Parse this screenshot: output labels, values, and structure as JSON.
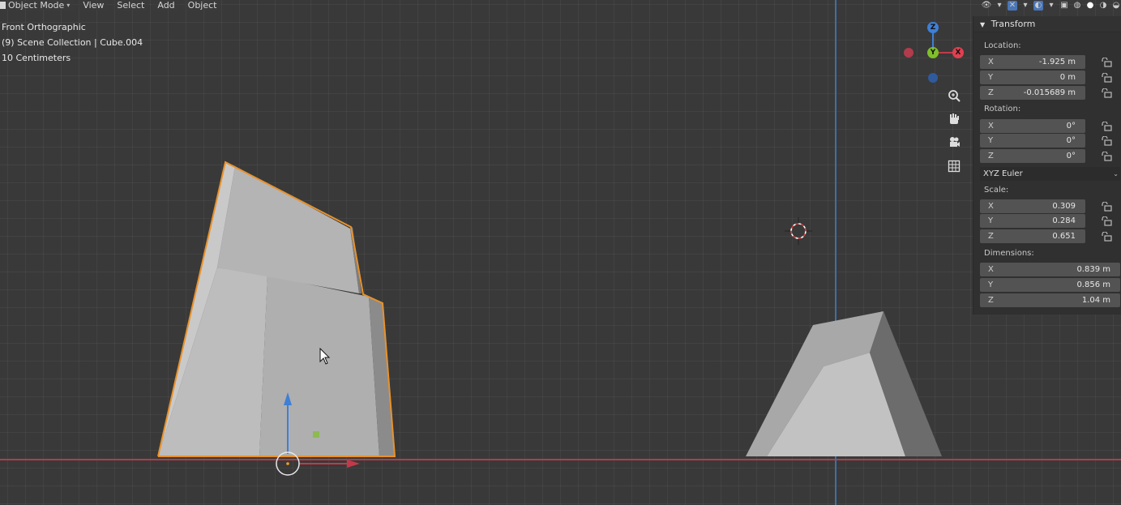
{
  "header": {
    "mode_label": "Object Mode",
    "menu": [
      "View",
      "Select",
      "Add",
      "Object"
    ]
  },
  "overlay": {
    "view_name": "Front Orthographic",
    "collection": "(9) Scene Collection | Cube.004",
    "scale_text": "10 Centimeters"
  },
  "gizmo": {
    "x": "X",
    "y": "Y",
    "z": "Z"
  },
  "panel": {
    "title": "Transform",
    "location": {
      "label": "Location:",
      "rows": [
        {
          "axis": "X",
          "value": "-1.925 m"
        },
        {
          "axis": "Y",
          "value": "0 m"
        },
        {
          "axis": "Z",
          "value": "-0.015689 m"
        }
      ]
    },
    "rotation": {
      "label": "Rotation:",
      "rows": [
        {
          "axis": "X",
          "value": "0°"
        },
        {
          "axis": "Y",
          "value": "0°"
        },
        {
          "axis": "Z",
          "value": "0°"
        }
      ]
    },
    "rotation_mode": "XYZ Euler",
    "scale": {
      "label": "Scale:",
      "rows": [
        {
          "axis": "X",
          "value": "0.309"
        },
        {
          "axis": "Y",
          "value": "0.284"
        },
        {
          "axis": "Z",
          "value": "0.651"
        }
      ]
    },
    "dimensions": {
      "label": "Dimensions:",
      "rows": [
        {
          "axis": "X",
          "value": "0.839 m"
        },
        {
          "axis": "Y",
          "value": "0.856 m"
        },
        {
          "axis": "Z",
          "value": "1.04 m"
        }
      ]
    }
  },
  "icons": {
    "nav": [
      "zoom-icon",
      "hand-pan-icon",
      "camera-icon",
      "grid-ortho-icon"
    ],
    "lock": "lock-open-icon"
  },
  "colors": {
    "selection_outline": "#e8922c",
    "x_axis": "#c23a4a",
    "y_axis": "#7fbf2a",
    "z_axis": "#3f7fd6"
  }
}
